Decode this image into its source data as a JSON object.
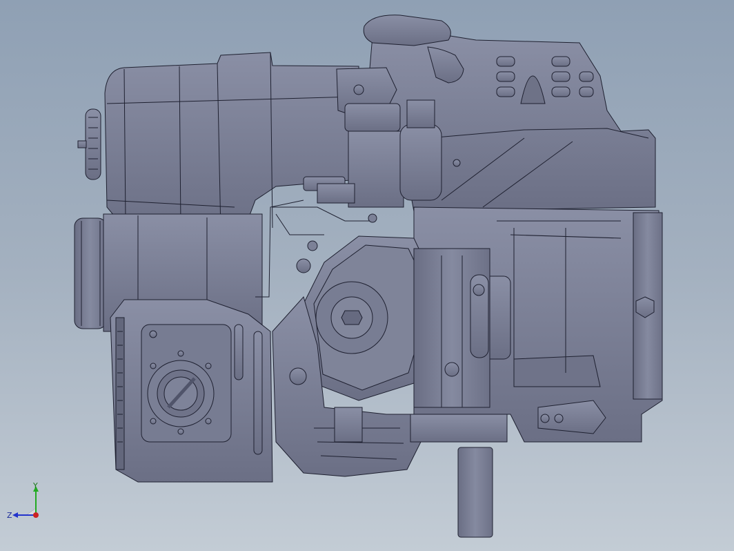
{
  "viewport": {
    "background_top": "#8fa0b4",
    "background_bottom": "#c3ccd5",
    "part_fill": "#7c8197",
    "part_shade": "#676b80",
    "edge_color": "#1e2030"
  },
  "triad": {
    "x_color": "#cc2222",
    "y_color": "#22aa22",
    "z_color": "#2233cc",
    "y_label": "Y",
    "z_label": "Z"
  }
}
